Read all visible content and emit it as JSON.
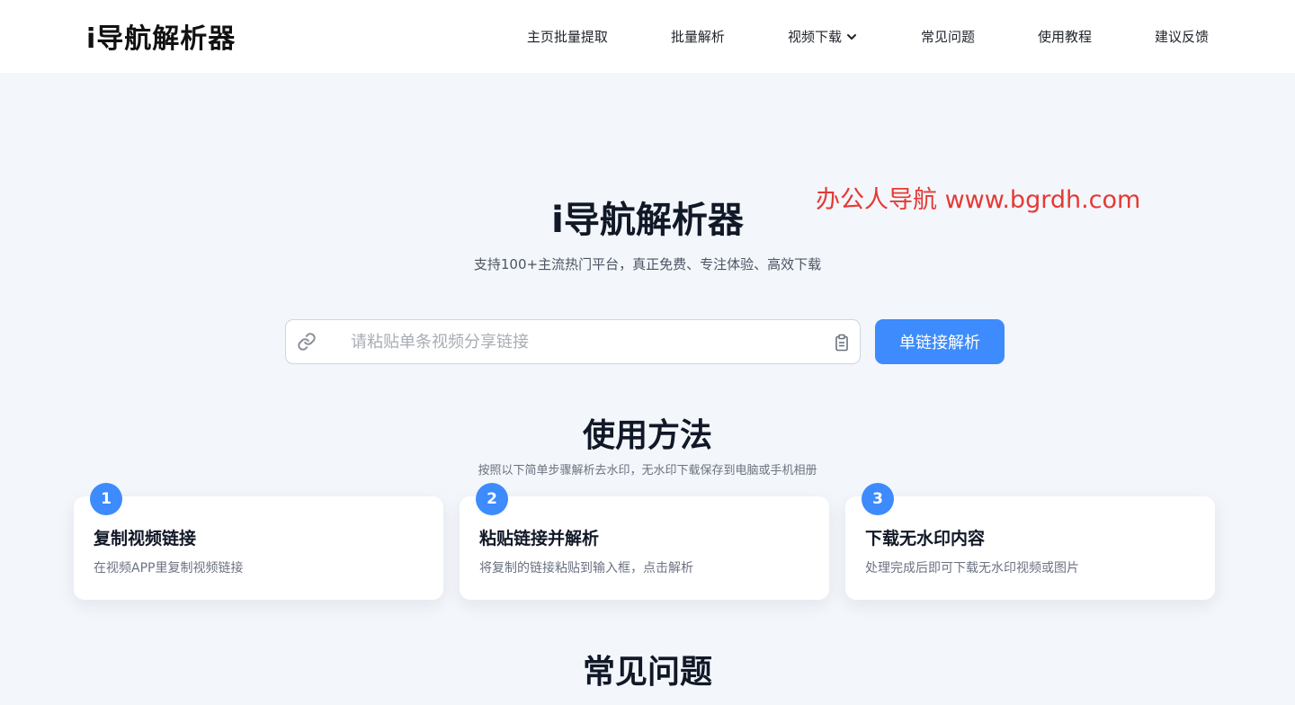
{
  "header": {
    "logo": "i导航解析器",
    "nav": [
      {
        "label": "主页批量提取"
      },
      {
        "label": "批量解析"
      },
      {
        "label": "视频下载",
        "has_dropdown": true
      },
      {
        "label": "常见问题"
      },
      {
        "label": "使用教程"
      },
      {
        "label": "建议反馈"
      }
    ]
  },
  "hero": {
    "title": "i导航解析器",
    "watermark": "办公人导航  www.bgrdh.com",
    "subtitle": "支持100+主流热门平台，真正免费、专注体验、高效下载"
  },
  "search": {
    "placeholder": "请粘贴单条视频分享链接",
    "value": "",
    "button_label": "单链接解析",
    "link_icon": "link-icon",
    "paste_icon": "clipboard-icon"
  },
  "usage": {
    "title": "使用方法",
    "subtitle": "按照以下简单步骤解析去水印，无水印下载保存到电脑或手机相册",
    "steps": [
      {
        "num": "1",
        "title": "复制视频链接",
        "desc": "在视频APP里复制视频链接"
      },
      {
        "num": "2",
        "title": "粘贴链接并解析",
        "desc": "将复制的链接粘贴到输入框，点击解析"
      },
      {
        "num": "3",
        "title": "下载无水印内容",
        "desc": "处理完成后即可下载无水印视频或图片"
      }
    ]
  },
  "faq": {
    "title": "常见问题"
  },
  "colors": {
    "accent": "#3d8bfd",
    "watermark": "#e53935",
    "background": "#f3f6fa"
  }
}
